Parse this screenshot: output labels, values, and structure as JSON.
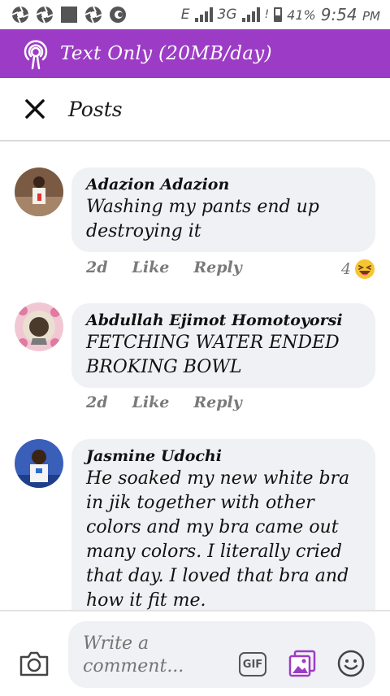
{
  "status_bar": {
    "network_label": "E",
    "network_label_2": "3G",
    "battery": "41%",
    "time": "9:54",
    "ampm": "PM"
  },
  "banner": {
    "text": "Text Only (20MB/day)",
    "icon": "broadcast-icon",
    "color": "#9c3cc6"
  },
  "header": {
    "title": "Posts",
    "close_icon": "close-icon"
  },
  "comments": [
    {
      "author": "Adazion Adazion",
      "text": "Washing my pants end up destroying it",
      "time": "2d",
      "like_label": "Like",
      "reply_label": "Reply",
      "reaction_count": "4",
      "reaction_icon": "laughing-emoji-icon"
    },
    {
      "author": "Abdullah Ejimot Homotoyorsi",
      "text": "FETCHING WATER ENDED BROKING BOWL",
      "time": "2d",
      "like_label": "Like",
      "reply_label": "Reply"
    },
    {
      "author": "Jasmine Udochi",
      "text": "He soaked my new white bra in jik together with other colors and my bra came out many colors. I literally cried that day. I loved that bra and how it fit me."
    }
  ],
  "composer": {
    "placeholder": "Write a comment...",
    "gif_label": "GIF",
    "camera_icon": "camera-icon",
    "photo_icon": "photo-icon",
    "emoji_icon": "smiley-icon"
  }
}
